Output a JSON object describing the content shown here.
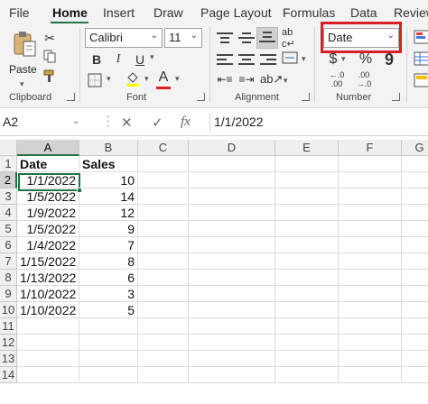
{
  "ribbon_tabs": [
    {
      "label": "File"
    },
    {
      "label": "Home"
    },
    {
      "label": "Insert"
    },
    {
      "label": "Draw"
    },
    {
      "label": "Page Layout"
    },
    {
      "label": "Formulas"
    },
    {
      "label": "Data"
    },
    {
      "label": "Review"
    }
  ],
  "active_tab": "Home",
  "clipboard": {
    "paste_label": "Paste",
    "group_label": "Clipboard"
  },
  "font": {
    "family": "Calibri",
    "size": "11",
    "group_label": "Font",
    "bold": "B",
    "italic": "I",
    "underline": "U"
  },
  "alignment": {
    "group_label": "Alignment"
  },
  "number": {
    "format": "Date",
    "group_label": "Number",
    "currency_symbol": "$",
    "percent_symbol": "%",
    "comma_symbol": "9"
  },
  "formula_bar": {
    "name_box": "A2",
    "formula": "1/1/2022",
    "fx_label": "fx"
  },
  "columns": [
    "A",
    "B",
    "C",
    "D",
    "E",
    "F",
    "G"
  ],
  "rows": [
    "1",
    "2",
    "3",
    "4",
    "5",
    "6",
    "7",
    "8",
    "9",
    "10",
    "11",
    "12",
    "13",
    "14"
  ],
  "cells": {
    "A1": "Date",
    "B1": "Sales",
    "A2": "1/1/2022",
    "B2": "10",
    "A3": "1/5/2022",
    "B3": "14",
    "A4": "1/9/2022",
    "B4": "12",
    "A5": "1/5/2022",
    "B5": "9",
    "A6": "1/4/2022",
    "B6": "7",
    "A7": "1/15/2022",
    "B7": "8",
    "A8": "1/13/2022",
    "B8": "6",
    "A9": "1/10/2022",
    "B9": "3",
    "A10": "1/10/2022",
    "B10": "5"
  },
  "colors": {
    "accent": "#217346",
    "highlight": "#d92027",
    "font_color_bar": "#e02020"
  }
}
